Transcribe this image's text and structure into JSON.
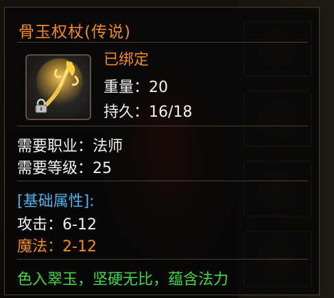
{
  "item": {
    "title": "骨玉权杖(传说)",
    "bound": "已绑定",
    "weight_label": "重量",
    "weight_value": "20",
    "durability_label": "持久",
    "durability_value": "16/18",
    "req_class_label": "需要职业",
    "req_class_value": "法师",
    "req_level_label": "需要等级",
    "req_level_value": "25",
    "base_attr_header": "[基础属性]:",
    "attack_label": "攻击",
    "attack_value": "6-12",
    "magic_label": "魔法",
    "magic_value": "2-12",
    "flavor_text": "色入翠玉，坚硬无比，蕴含法力",
    "colon": "："
  },
  "colors": {
    "title": "#ef8a2a",
    "bound": "#ef8a2a",
    "attribute_header": "#4fb0ec",
    "magic": "#ef8a2a",
    "flavor": "#3fd64a",
    "stat_text": "#f2f2f0"
  },
  "icons": {
    "item": "bone-jade-scepter-icon",
    "lock": "lock-icon"
  }
}
